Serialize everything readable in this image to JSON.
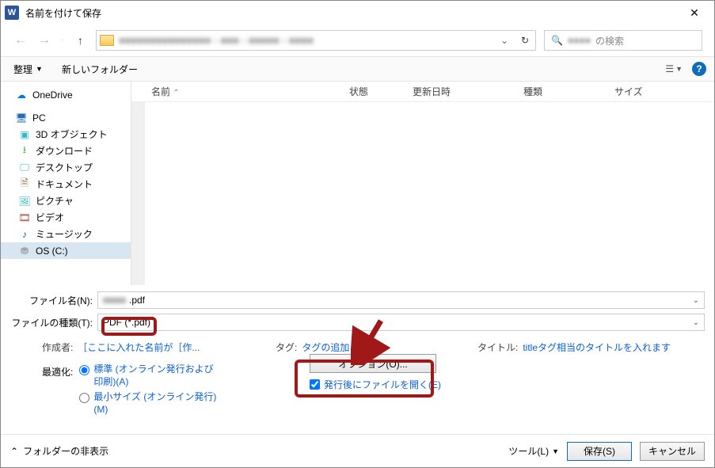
{
  "window": {
    "title": "名前を付けて保存",
    "close": "✕"
  },
  "nav": {
    "address_blur": "■■■■■■■■■■■■■■■  ›  ■■■  ›  ■■■■■  ›  ■■■■",
    "search_blur": "■■■■",
    "search_suffix": "の検索"
  },
  "toolbar": {
    "organize": "整理",
    "new_folder": "新しいフォルダー"
  },
  "tree": [
    {
      "icon": "onedrive",
      "label": "OneDrive",
      "top": true
    },
    {
      "icon": "pc",
      "label": "PC",
      "top": true
    },
    {
      "icon": "3d",
      "label": "3D オブジェクト"
    },
    {
      "icon": "dl",
      "label": "ダウンロード"
    },
    {
      "icon": "desktop",
      "label": "デスクトップ"
    },
    {
      "icon": "doc",
      "label": "ドキュメント"
    },
    {
      "icon": "pic",
      "label": "ピクチャ"
    },
    {
      "icon": "video",
      "label": "ビデオ"
    },
    {
      "icon": "music",
      "label": "ミュージック"
    },
    {
      "icon": "disk",
      "label": "OS (C:)",
      "sel": true
    }
  ],
  "columns": {
    "name": "名前",
    "state": "状態",
    "date": "更新日時",
    "type": "種類",
    "size": "サイズ"
  },
  "form": {
    "filename_label": "ファイル名(N):",
    "filename_blur": "■■■■",
    "filename_ext": ".pdf",
    "filetype_label": "ファイルの種類(T):",
    "filetype_value": "PDF (*.pdf)"
  },
  "meta": {
    "author_label": "作成者:",
    "author_value": "［ここに入れた名前が［作...",
    "tag_label": "タグ:",
    "tag_value": "タグの追加",
    "title_label": "タイトル:",
    "title_value": "titleタグ相当のタイトルを入れます"
  },
  "optimize": {
    "label": "最適化:",
    "opt1": "標準 (オンライン発行および印刷)(A)",
    "opt2": "最小サイズ (オンライン発行)(M)"
  },
  "center": {
    "options_btn": "オプション(O)...",
    "open_after": "発行後にファイルを開く(E)"
  },
  "footer": {
    "hide_folders": "フォルダーの非表示",
    "tools": "ツール(L)",
    "save": "保存(S)",
    "cancel": "キャンセル"
  }
}
